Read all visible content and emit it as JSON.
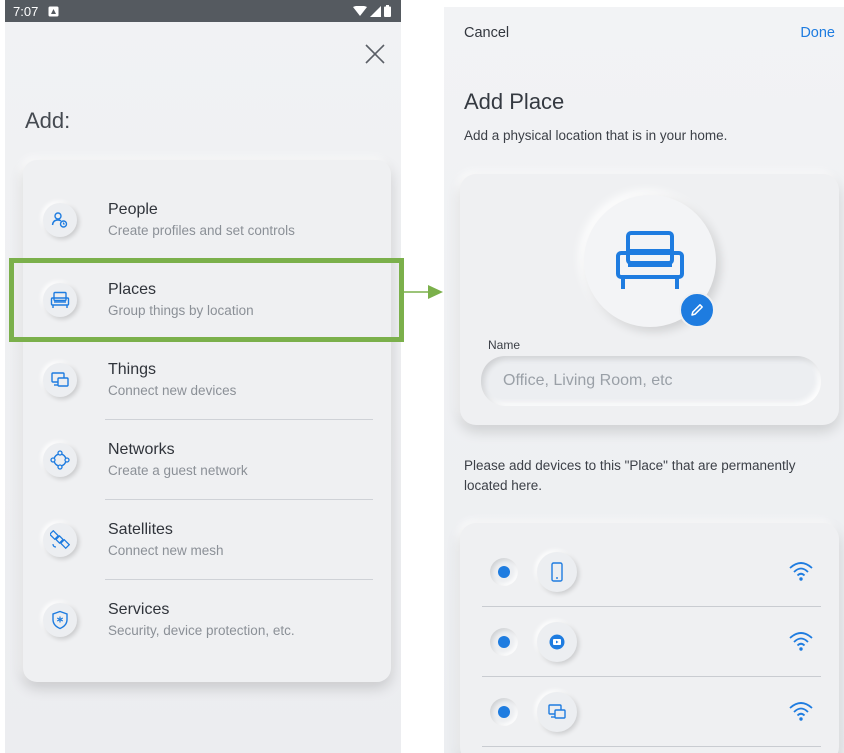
{
  "status_bar": {
    "time": "7:07"
  },
  "add_screen": {
    "title": "Add:",
    "close_icon": "close-icon",
    "items": [
      {
        "key": "people",
        "label": "People",
        "subtitle": "Create profiles and set controls",
        "icon": "people-icon"
      },
      {
        "key": "places",
        "label": "Places",
        "subtitle": "Group things by location",
        "icon": "armchair-icon"
      },
      {
        "key": "things",
        "label": "Things",
        "subtitle": "Connect new devices",
        "icon": "devices-icon"
      },
      {
        "key": "networks",
        "label": "Networks",
        "subtitle": "Create a guest network",
        "icon": "network-icon"
      },
      {
        "key": "satellites",
        "label": "Satellites",
        "subtitle": "Connect new mesh",
        "icon": "satellite-icon"
      },
      {
        "key": "services",
        "label": "Services",
        "subtitle": "Security, device protection, etc.",
        "icon": "shield-icon"
      }
    ]
  },
  "annotation": {
    "highlight_color": "#7bb04b",
    "highlighted_item": "places"
  },
  "add_place_screen": {
    "cancel_label": "Cancel",
    "done_label": "Done",
    "title": "Add Place",
    "subtitle": "Add a physical location that is in your home.",
    "name_label": "Name",
    "name_placeholder": "Office, Living Room, etc",
    "devices_note": "Please add devices to this \"Place\" that are permanently located here.",
    "devices": [
      {
        "icon": "phone-icon",
        "selected": true
      },
      {
        "icon": "media-icon",
        "selected": true
      },
      {
        "icon": "devices-icon",
        "selected": true
      }
    ]
  },
  "colors": {
    "accent": "#1e7ce0",
    "highlight": "#7bb04b",
    "status_bar": "#555a60"
  }
}
